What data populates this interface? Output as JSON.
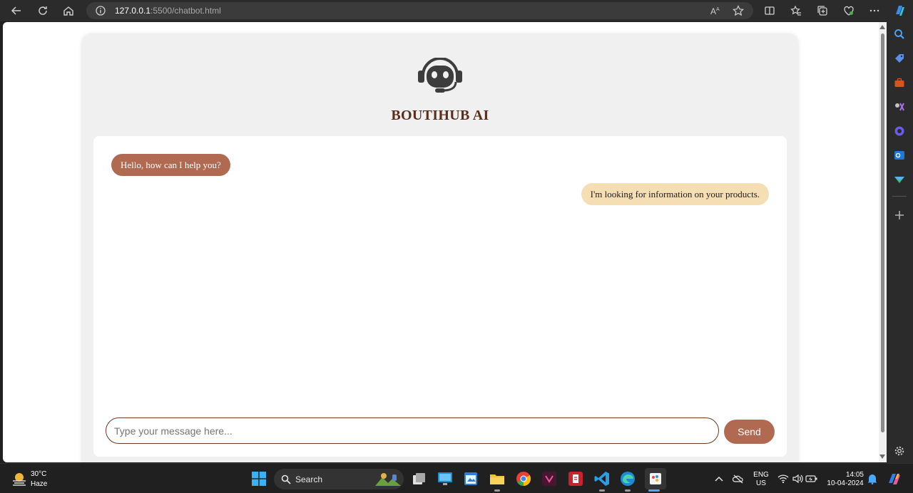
{
  "browser": {
    "url_host": "127.0.0.1",
    "url_rest": ":5500/chatbot.html",
    "accent": "#2b2b2b"
  },
  "page": {
    "title": "BOUTIHUB AI",
    "messages": [
      {
        "sender": "bot",
        "text": "Hello, how can I help you?"
      },
      {
        "sender": "user",
        "text": "I'm looking for information on your products."
      }
    ],
    "input": {
      "placeholder": "Type your message here...",
      "value": ""
    },
    "send_label": "Send",
    "colors": {
      "bot_bubble": "#b06a52",
      "user_bubble": "#f6deb4",
      "title": "#5a2e1b",
      "send_button": "#b06a52",
      "panel": "#f0f0f0"
    },
    "logo_icon": "robot-headset-icon"
  },
  "taskbar": {
    "weather": {
      "temp": "30°C",
      "condition": "Haze"
    },
    "search_label": "Search",
    "language": {
      "line1": "ENG",
      "line2": "US"
    },
    "clock": {
      "time": "14:05",
      "date": "10-04-2024"
    }
  }
}
